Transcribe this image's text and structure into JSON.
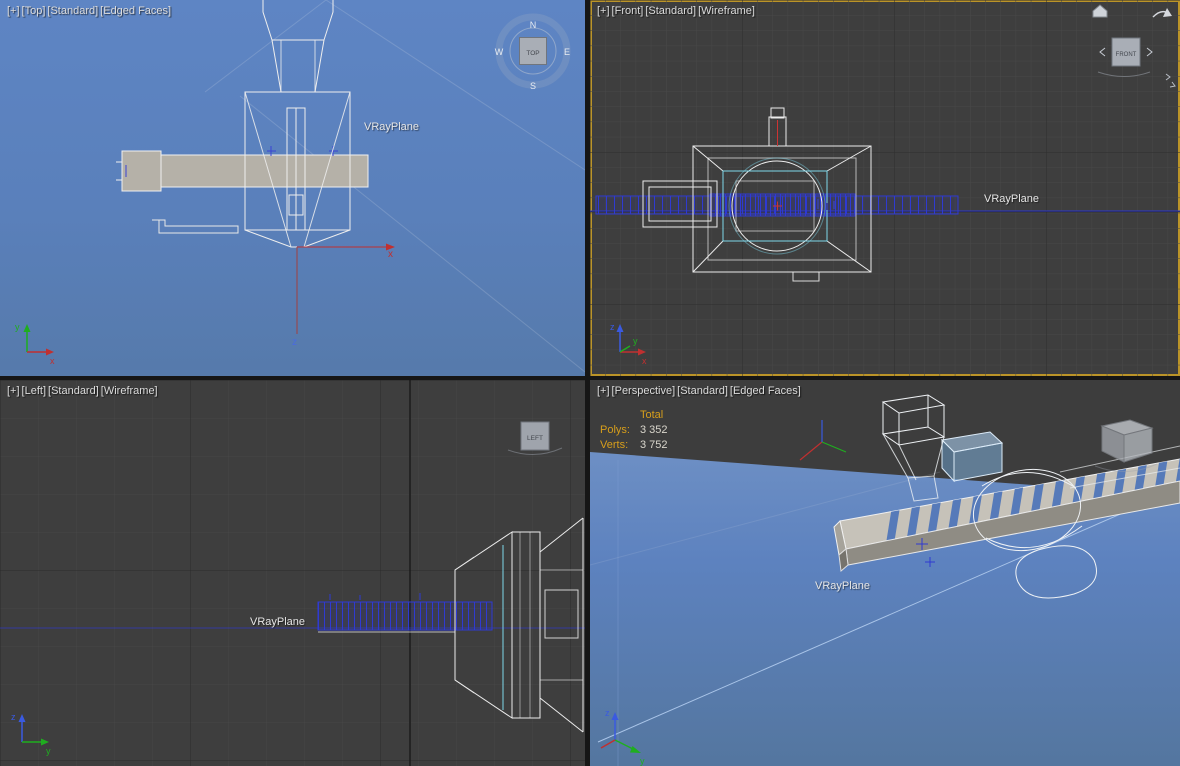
{
  "axis": {
    "x": "x",
    "y": "y",
    "z": "z"
  },
  "colors": {
    "shaded_bg": "#5b81bf",
    "wireframe_bg": "#3e3e3e",
    "active_viewport_border": "#bb9428",
    "selection_blue": "#2f3ad2",
    "highlight_cyan": "#7fd8ea",
    "stats_accent": "#d79e1b",
    "label_text": "#dcdcdc"
  },
  "viewports": {
    "top": {
      "menu": [
        "[+]",
        "[Top]",
        "[Standard]",
        "[Edged Faces]"
      ],
      "object_label": "VRayPlane",
      "viewcube_face": "TOP",
      "compass": {
        "n": "N",
        "e": "E",
        "s": "S",
        "w": "W"
      }
    },
    "front": {
      "menu": [
        "[+]",
        "[Front]",
        "[Standard]",
        "[Wireframe]"
      ],
      "object_label": "VRayPlane",
      "viewcube_face": "FRONT"
    },
    "left": {
      "menu": [
        "[+]",
        "[Left]",
        "[Standard]",
        "[Wireframe]"
      ],
      "object_label": "VRayPlane",
      "viewcube_face": "LEFT"
    },
    "perspective": {
      "menu": [
        "[+]",
        "[Perspective]",
        "[Standard]",
        "[Edged Faces]"
      ],
      "object_label": "VRayPlane",
      "stats": {
        "title": "Total",
        "rows": [
          {
            "label": "Polys:",
            "value": "3 352"
          },
          {
            "label": "Verts:",
            "value": "3 752"
          }
        ]
      }
    }
  }
}
